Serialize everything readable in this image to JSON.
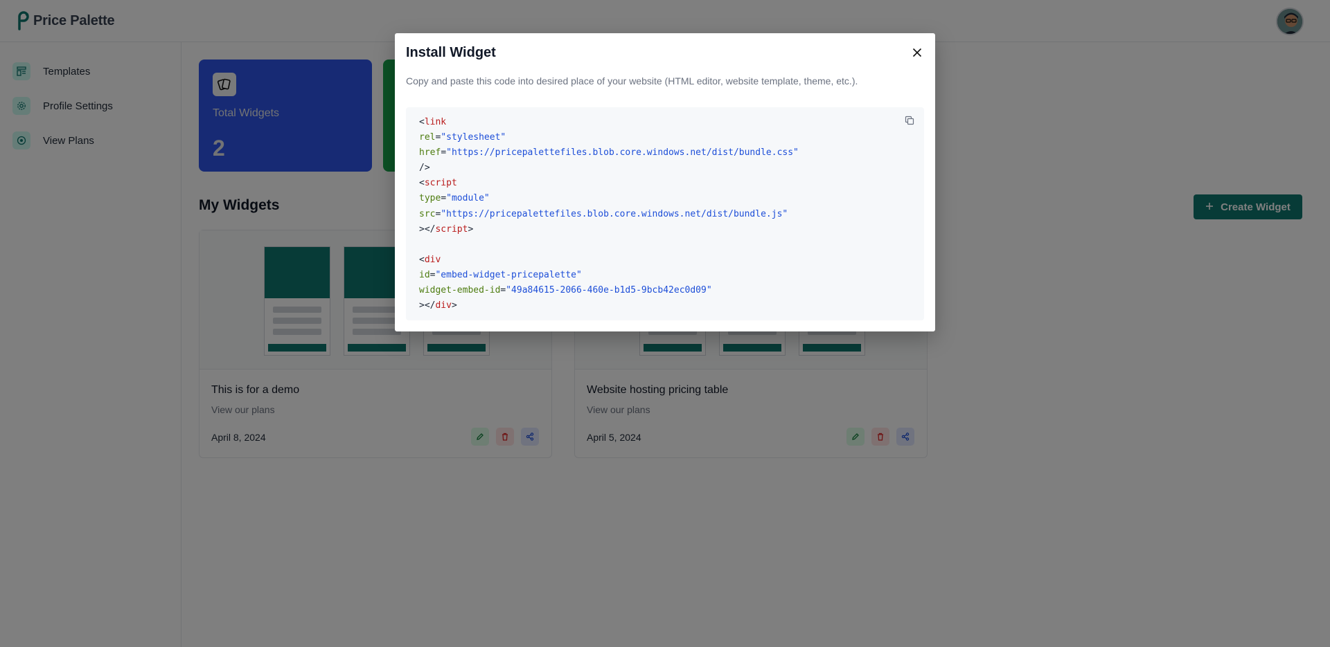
{
  "app": {
    "name": "Price Palette"
  },
  "sidebar": {
    "items": [
      {
        "label": "Templates",
        "icon": "templates-icon"
      },
      {
        "label": "Profile Settings",
        "icon": "gear-icon"
      },
      {
        "label": "View Plans",
        "icon": "plans-icon"
      }
    ]
  },
  "stats": {
    "total_widgets": {
      "label": "Total Widgets",
      "value": "2"
    }
  },
  "main": {
    "section_title": "My Widgets",
    "create_button": "Create Widget",
    "widgets": [
      {
        "title": "This is for a demo",
        "subtitle": "View our plans",
        "date": "April 8, 2024"
      },
      {
        "title": "Website hosting pricing table",
        "subtitle": "View our plans",
        "date": "April 5, 2024"
      }
    ]
  },
  "modal": {
    "title": "Install Widget",
    "description": "Copy and paste this code into desired place of your website (HTML editor, website template, theme, etc.).",
    "code": {
      "link_tag": "link",
      "rel_attr": "rel",
      "rel_value": "\"stylesheet\"",
      "href_attr": "href",
      "href_value": "\"https://pricepalettefiles.blob.core.windows.net/dist/bundle.css\"",
      "self_close": "/>",
      "script_tag": "script",
      "type_attr": "type",
      "type_value": "\"module\"",
      "src_attr": "src",
      "src_value": "\"https://pricepalettefiles.blob.core.windows.net/dist/bundle.js\"",
      "div_tag": "div",
      "id_attr": "id",
      "id_value": "\"embed-widget-pricepalette\"",
      "embed_attr": "widget-embed-id",
      "embed_value": "\"49a84615-2066-460e-b1d5-9bcb42ec0d09\""
    }
  },
  "colors": {
    "accent": "#0f766e",
    "stat_blue": "#2f55e8",
    "stat_green": "#16a34a"
  }
}
